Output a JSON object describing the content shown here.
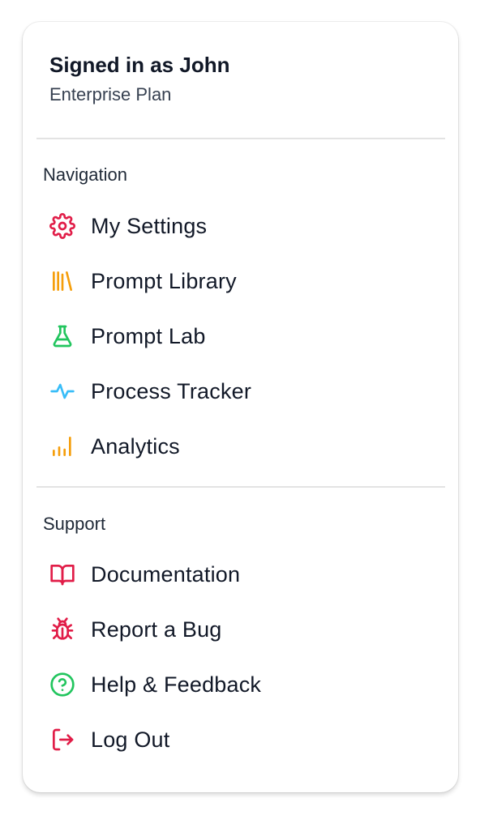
{
  "header": {
    "signed_in": "Signed in as John",
    "plan": "Enterprise Plan"
  },
  "navigation": {
    "title": "Navigation",
    "items": [
      {
        "label": "My Settings",
        "icon": "gear-icon",
        "color": "#e11d48"
      },
      {
        "label": "Prompt Library",
        "icon": "library-icon",
        "color": "#f59e0b"
      },
      {
        "label": "Prompt Lab",
        "icon": "flask-icon",
        "color": "#22c55e"
      },
      {
        "label": "Process Tracker",
        "icon": "pulse-icon",
        "color": "#38bdf8"
      },
      {
        "label": "Analytics",
        "icon": "bar-chart-icon",
        "color": "#f59e0b"
      }
    ]
  },
  "support": {
    "title": "Support",
    "items": [
      {
        "label": "Documentation",
        "icon": "book-icon",
        "color": "#e11d48"
      },
      {
        "label": "Report a Bug",
        "icon": "bug-icon",
        "color": "#e11d48"
      },
      {
        "label": "Help & Feedback",
        "icon": "help-circle-icon",
        "color": "#22c55e"
      },
      {
        "label": "Log Out",
        "icon": "logout-icon",
        "color": "#e11d48"
      }
    ]
  }
}
